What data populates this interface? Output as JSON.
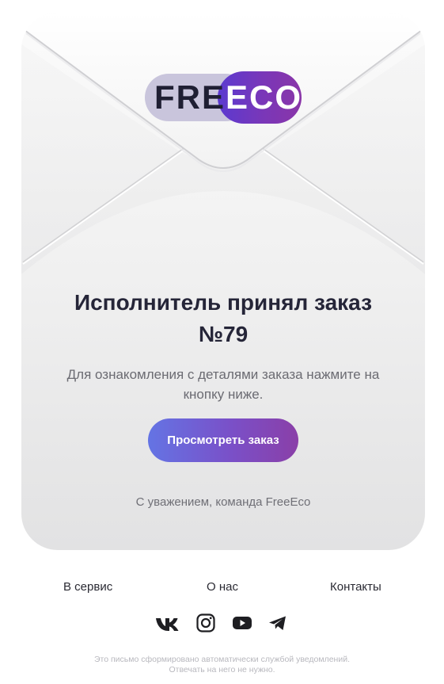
{
  "brand": {
    "logo_part_dark": "FRE",
    "logo_part_light": "ECO",
    "accent_start": "#6474e4",
    "accent_end": "#8a3fa8"
  },
  "message": {
    "title_line1": "Исполнитель принял заказ",
    "title_line2": "№79",
    "description_line1": "Для ознакомления с деталями заказа нажмите на",
    "description_line2": "кнопку ниже.",
    "button_label": "Просмотреть заказ",
    "regards": "С уважением, команда FreeEco"
  },
  "footer": {
    "links": [
      "В сервис",
      "О нас",
      "Контакты"
    ],
    "socials": [
      "vk-icon",
      "instagram-icon",
      "youtube-icon",
      "telegram-icon"
    ],
    "notice_line1": "Это письмо сформировано автоматически службой уведомлений.",
    "notice_line2": "Отвечать на него не нужно."
  }
}
